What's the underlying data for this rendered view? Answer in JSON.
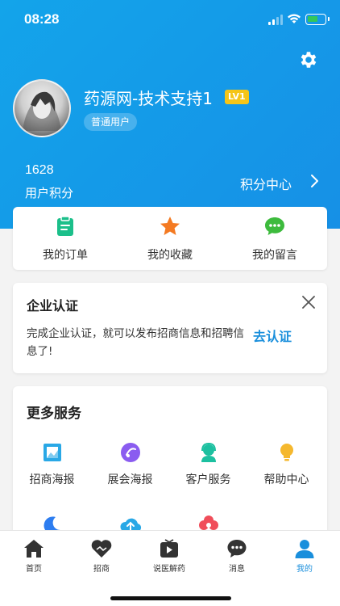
{
  "status_bar": {
    "time": "08:28"
  },
  "profile": {
    "username": "药源网-技术支持1",
    "level": "LV1",
    "user_type": "普通用户",
    "points_value": "1628",
    "points_label": "用户积分",
    "points_center": "积分中心"
  },
  "quick_actions": [
    {
      "label": "我的订单",
      "icon": "clipboard-icon",
      "color": "#1bbf8a"
    },
    {
      "label": "我的收藏",
      "icon": "star-icon",
      "color": "#f47a22"
    },
    {
      "label": "我的留言",
      "icon": "chat-bubble-icon",
      "color": "#3dbb3d"
    }
  ],
  "certification": {
    "title": "企业认证",
    "text": "完成企业认证，就可以发布招商信息和招聘信息了!",
    "link": "去认证"
  },
  "services": {
    "title": "更多服务",
    "items": [
      {
        "label": "招商海报",
        "icon": "poster-icon",
        "color": "#29a8e6"
      },
      {
        "label": "展会海报",
        "icon": "exhibition-icon",
        "color": "#8a5cf0"
      },
      {
        "label": "客户服务",
        "icon": "customer-service-icon",
        "color": "#1cc0a0"
      },
      {
        "label": "帮助中心",
        "icon": "lightbulb-icon",
        "color": "#f5b82e"
      },
      {
        "label": "",
        "icon": "moon-icon",
        "color": "#2d7df0"
      },
      {
        "label": "",
        "icon": "upload-cloud-icon",
        "color": "#29a8e6"
      },
      {
        "label": "",
        "icon": "flower-icon",
        "color": "#f04d5a"
      }
    ]
  },
  "tabbar": {
    "active_color": "#1a8fdc",
    "items": [
      {
        "label": "首页",
        "icon": "home-icon"
      },
      {
        "label": "招商",
        "icon": "handshake-icon"
      },
      {
        "label": "说医解药",
        "icon": "video-play-icon"
      },
      {
        "label": "消息",
        "icon": "message-icon"
      },
      {
        "label": "我的",
        "icon": "user-icon"
      }
    ]
  }
}
